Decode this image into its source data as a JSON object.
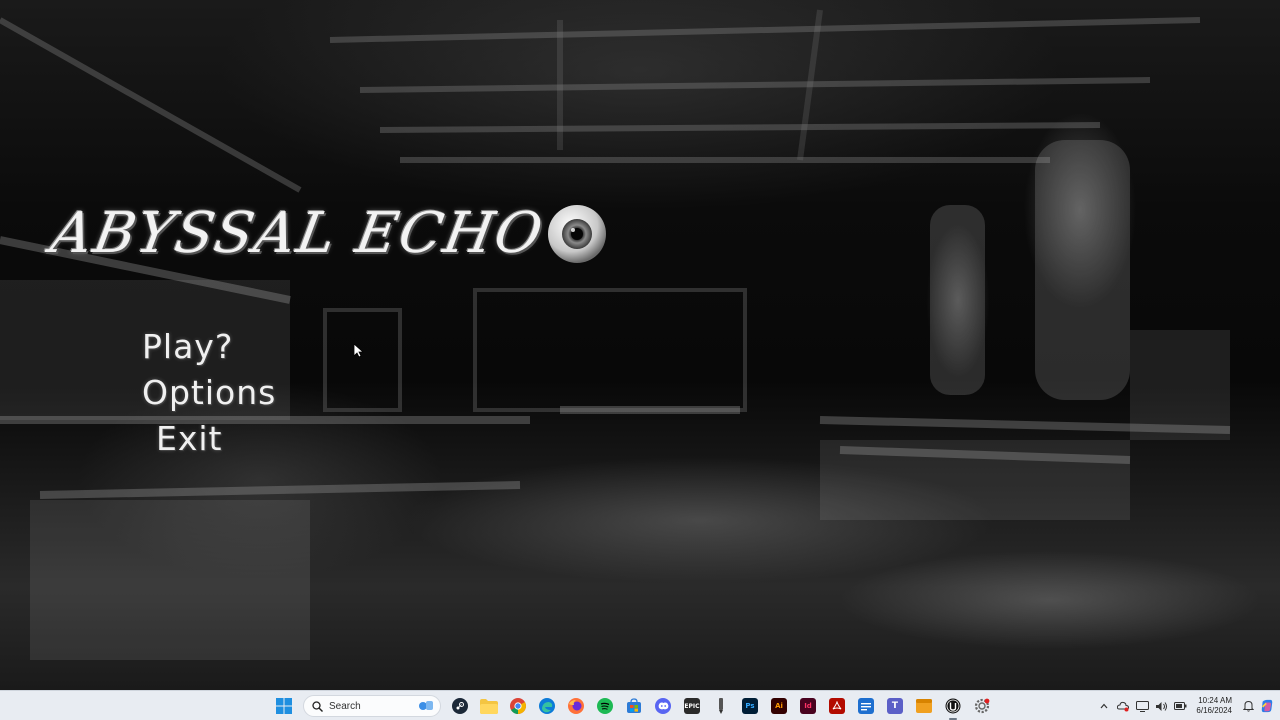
{
  "game": {
    "title": "ABYSSAL ECHO",
    "menu": {
      "play": "Play?",
      "options": "Options",
      "exit": "Exit"
    }
  },
  "taskbar": {
    "search_placeholder": "Search",
    "apps": [
      "windows-start",
      "search",
      "steam",
      "file-explorer",
      "chrome",
      "edge",
      "firefox",
      "spotify",
      "microsoft-store",
      "discord",
      "epic-games",
      "pen-tool",
      "photoshop",
      "illustrator",
      "indesign",
      "acrobat",
      "word-view",
      "teams",
      "notes",
      "unreal-engine",
      "settings"
    ],
    "epic_label": "EPIC",
    "ps_label": "Ps",
    "ai_label": "Ai",
    "id_label": "Id",
    "clock": {
      "time": "10:24 AM",
      "date": "6/16/2024"
    },
    "colors": {
      "taskbar_bg": "#e8ecf2",
      "steam": "#1b2838",
      "spotify": "#1db954",
      "discord": "#5865f2",
      "photoshop": "#001e36",
      "illustrator": "#330000",
      "indesign": "#49021f",
      "acrobat": "#b30b00",
      "teams": "#5b5fc7"
    }
  }
}
